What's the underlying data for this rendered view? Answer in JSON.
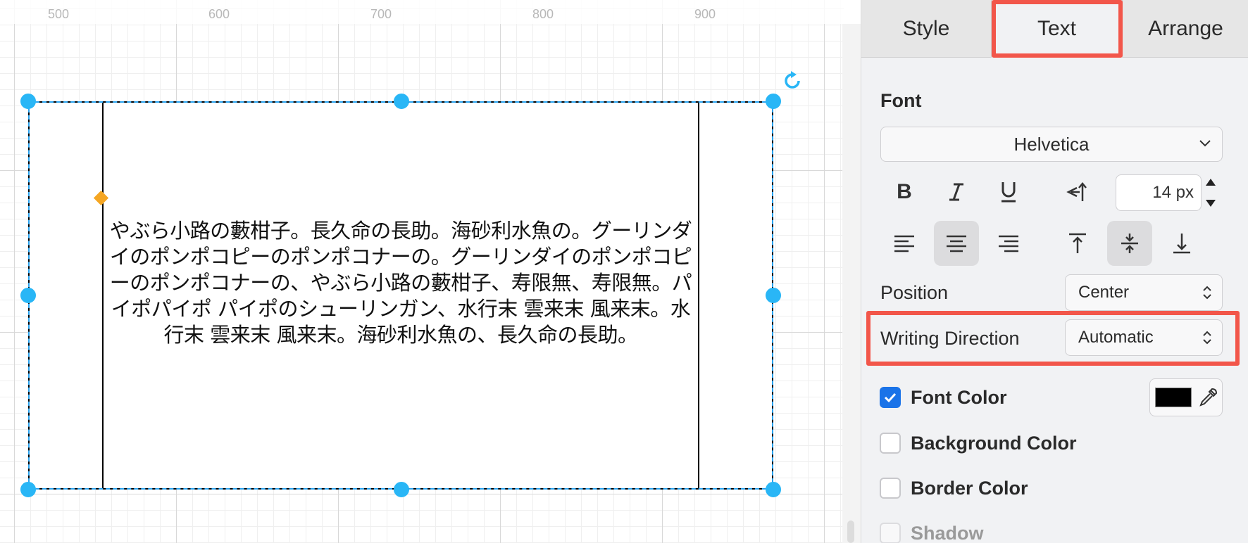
{
  "ruler": {
    "labels": [
      "500",
      "600",
      "700",
      "800",
      "900"
    ]
  },
  "shape": {
    "text": "やぶら小路の藪柑子。長久命の長助。海砂利水魚の。グーリンダイのポンポコピーのポンポコナーの。グーリンダイのポンポコピーのポンポコナーの、やぶら小路の藪柑子、寿限無、寿限無。パイポパイポ パイポのシューリンガン、水行末 雲来末 風来末。水行末 雲来末 風来末。海砂利水魚の、長久命の長助。"
  },
  "tabs": {
    "style": "Style",
    "text": "Text",
    "arrange": "Arrange"
  },
  "font": {
    "title": "Font",
    "family": "Helvetica",
    "size": "14 px"
  },
  "format_icons": {
    "bold": "bold-icon",
    "italic": "italic-icon",
    "underline": "underline-icon",
    "vertical": "text-direction-icon",
    "align_left": "align-left-icon",
    "align_center": "align-center-icon",
    "align_right": "align-right-icon",
    "align_top": "align-top-icon",
    "align_middle": "align-middle-icon",
    "align_bottom": "align-bottom-icon"
  },
  "position": {
    "label": "Position",
    "value": "Center"
  },
  "writing_direction": {
    "label": "Writing Direction",
    "value": "Automatic"
  },
  "checkboxes": [
    {
      "label": "Font Color",
      "checked": true
    },
    {
      "label": "Background Color",
      "checked": false
    },
    {
      "label": "Border Color",
      "checked": false
    },
    {
      "label": "Shadow",
      "checked": false
    }
  ],
  "colors": {
    "accent": "#29b6f6",
    "highlight": "#f2564a",
    "font_color": "#000000",
    "checkbox": "#1a73e8"
  }
}
